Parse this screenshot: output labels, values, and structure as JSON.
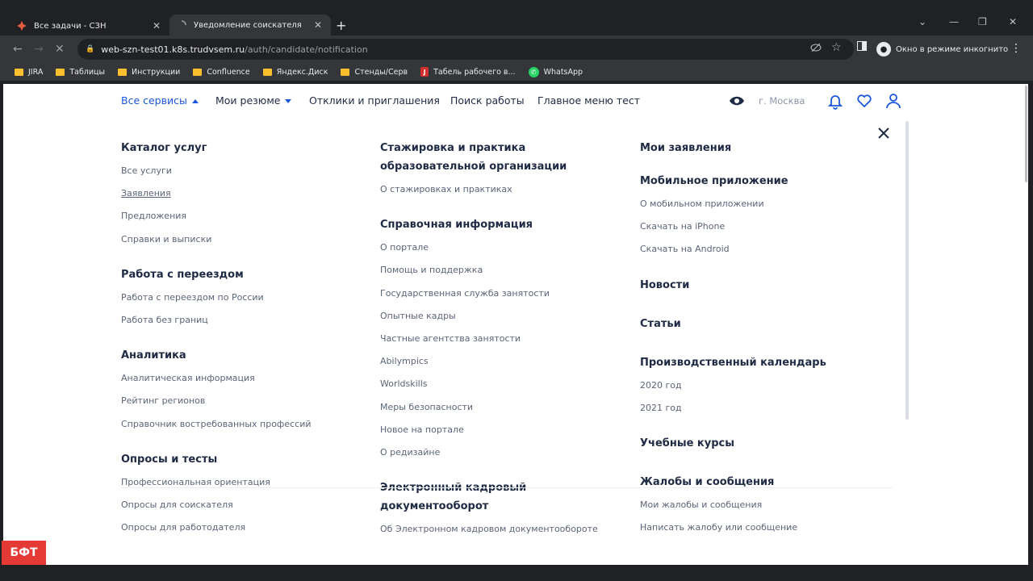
{
  "browser": {
    "tabs": [
      {
        "title": "Все задачи - СЗН",
        "active": false
      },
      {
        "title": "Уведомление соискателя",
        "active": true
      }
    ],
    "address": {
      "host": "web-szn-test01.k8s.trudvsem.ru",
      "path": "/auth/candidate/notification"
    },
    "incognito_label": "Окно в режиме инкогнито",
    "bookmarks": [
      {
        "label": "JIRA",
        "icon": "folder-icon"
      },
      {
        "label": "Таблицы",
        "icon": "folder-icon"
      },
      {
        "label": "Инструкции",
        "icon": "folder-icon"
      },
      {
        "label": "Confluence",
        "icon": "folder-icon"
      },
      {
        "label": "Яндекс.Диск",
        "icon": "folder-icon"
      },
      {
        "label": "Стенды/Серв",
        "icon": "folder-icon"
      },
      {
        "label": "Табель рабочего в...",
        "icon": "j-icon"
      },
      {
        "label": "WhatsApp",
        "icon": "whatsapp-icon"
      }
    ]
  },
  "site_nav": {
    "all_services": "Все сервисы",
    "my_resumes": "Мои резюме",
    "responses": "Отклики и приглашения",
    "job_search": "Поиск работы",
    "main_menu": "Главное меню тест",
    "city": "г. Москва"
  },
  "menu": {
    "col1": [
      {
        "title": "Каталог услуг",
        "items": [
          "Все услуги",
          "Заявления",
          "Предложения",
          "Справки и выписки"
        ]
      },
      {
        "title": "Работа с переездом",
        "items": [
          "Работа с переездом по России",
          "Работа без границ"
        ]
      },
      {
        "title": "Аналитика",
        "items": [
          "Аналитическая информация",
          "Рейтинг регионов",
          "Справочник востребованных профессий"
        ]
      },
      {
        "title": "Опросы и тесты",
        "items": [
          "Профессиональная ориентация",
          "Опросы для соискателя",
          "Опросы для работодателя"
        ]
      }
    ],
    "col2": [
      {
        "title": "Стажировка и практика образовательной организации",
        "items": [
          "О стажировках и практиках"
        ]
      },
      {
        "title": "Справочная информация",
        "items": [
          "О портале",
          "Помощь и поддержка",
          "Государственная служба занятости",
          "Опытные кадры",
          "Частные агентства занятости",
          "Abilympics",
          "Worldskills",
          "Меры безопасности",
          "Новое на портале",
          "О редизайне"
        ]
      },
      {
        "title": "Электронный кадровый документооборот",
        "items": [
          "Об Электронном кадровом документообороте"
        ]
      }
    ],
    "col3": [
      {
        "title": "Мои заявления",
        "items": []
      },
      {
        "title": "Мобильное приложение",
        "items": [
          "О мобильном приложении",
          "Скачать на iPhone",
          "Скачать на Android"
        ]
      },
      {
        "title": "Новости",
        "items": []
      },
      {
        "title": "Статьи",
        "items": []
      },
      {
        "title": "Производственный календарь",
        "items": [
          "2020 год",
          "2021 год"
        ]
      },
      {
        "title": "Учебные курсы",
        "items": []
      },
      {
        "title": "Жалобы и сообщения",
        "items": [
          "Мои жалобы и сообщения",
          "Написать жалобу или сообщение"
        ]
      }
    ]
  },
  "watermark": "БФТ",
  "colors": {
    "accent": "#1a56db",
    "heading": "#1f2a44",
    "link": "#5b6478"
  }
}
